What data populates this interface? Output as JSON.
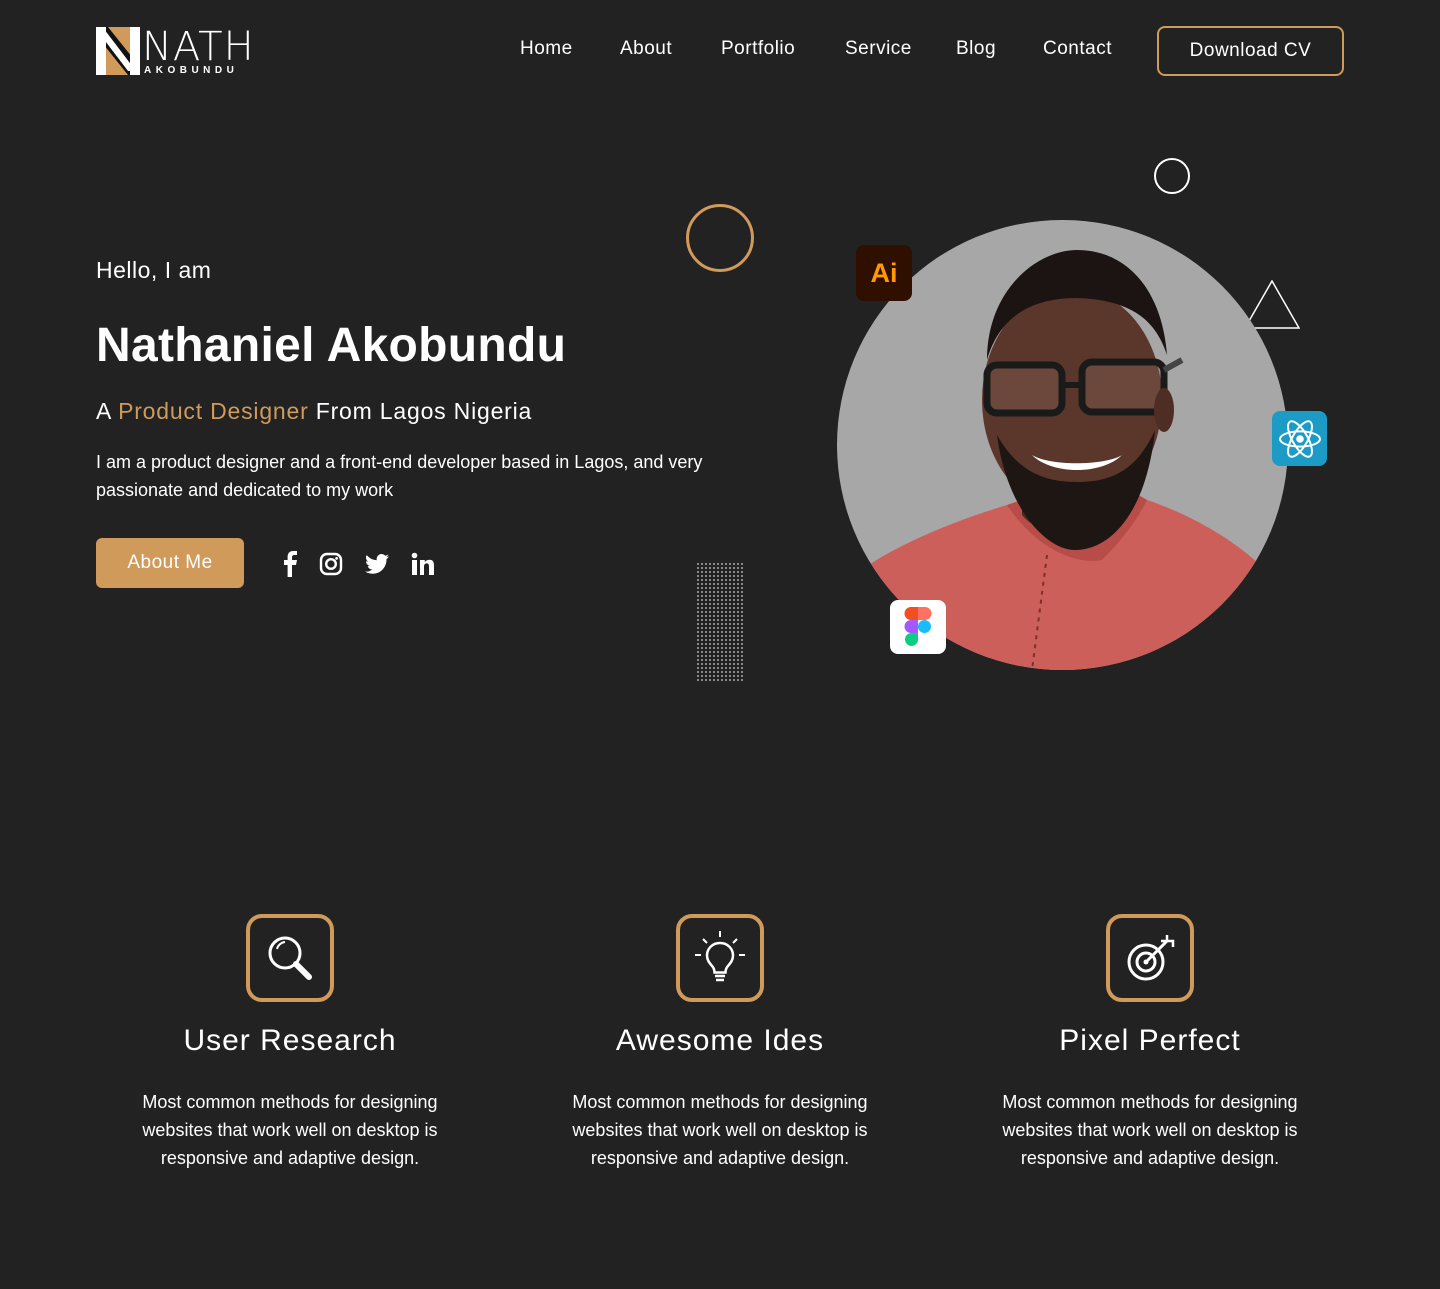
{
  "brand": {
    "word": "NATH",
    "sub": "AKOBUNDU"
  },
  "nav": {
    "items": [
      "Home",
      "About",
      "Portfolio",
      "Service",
      "Blog",
      "Contact"
    ],
    "cv_label": "Download CV"
  },
  "hero": {
    "greeting": "Hello, I am",
    "name": "Nathaniel Akobundu",
    "role_prefix": "A ",
    "role_highlight": "Product Designer",
    "role_suffix": " From Lagos Nigeria",
    "bio": "I am a product designer and a front-end developer based in Lagos, and very passionate and dedicated to my work",
    "about_label": "About Me",
    "social_icons": [
      "facebook-icon",
      "instagram-icon",
      "twitter-icon",
      "linkedin-icon"
    ],
    "tool_badges": {
      "illustrator": "Ai",
      "react": "react-icon",
      "figma": "figma-icon"
    }
  },
  "features": [
    {
      "icon": "search-icon",
      "title": "User Research",
      "text": "Most common methods for designing websites that work well on desktop is responsive and adaptive design."
    },
    {
      "icon": "lightbulb-icon",
      "title": "Awesome Ides",
      "text": "Most common methods for designing websites that work well on desktop is responsive and adaptive design."
    },
    {
      "icon": "target-icon",
      "title": "Pixel Perfect",
      "text": "Most common methods for designing websites that work well on desktop is responsive and adaptive design."
    }
  ],
  "colors": {
    "background": "#222222",
    "accent": "#cf9a5a",
    "text": "#ffffff"
  }
}
